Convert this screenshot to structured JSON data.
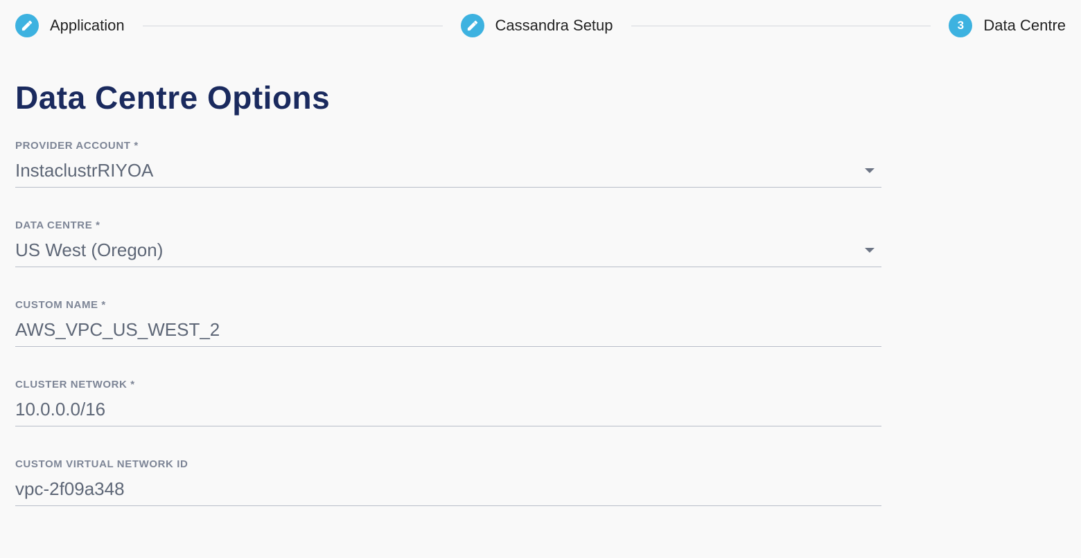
{
  "stepper": {
    "steps": [
      {
        "label": "Application",
        "badge_kind": "edit",
        "badge_text": ""
      },
      {
        "label": "Cassandra Setup",
        "badge_kind": "edit",
        "badge_text": ""
      },
      {
        "label": "Data Centre",
        "badge_kind": "number",
        "badge_text": "3"
      }
    ]
  },
  "page": {
    "title": "Data Centre Options"
  },
  "fields": {
    "provider_account": {
      "label": "PROVIDER ACCOUNT *",
      "value": "InstaclustrRIYOA"
    },
    "data_centre": {
      "label": "DATA CENTRE *",
      "value": "US West (Oregon)"
    },
    "custom_name": {
      "label": "CUSTOM NAME *",
      "value": "AWS_VPC_US_WEST_2"
    },
    "cluster_network": {
      "label": "CLUSTER NETWORK *",
      "value": "10.0.0.0/16"
    },
    "custom_vnet_id": {
      "label": "CUSTOM VIRTUAL NETWORK ID",
      "value": "vpc-2f09a348"
    }
  }
}
